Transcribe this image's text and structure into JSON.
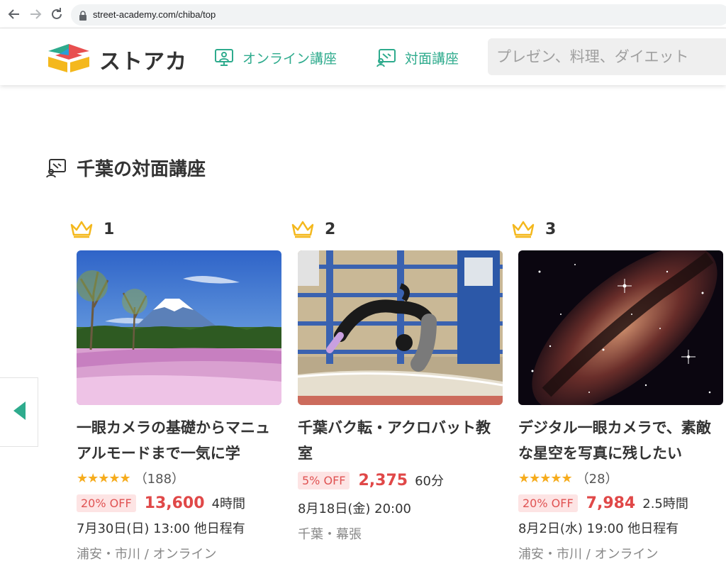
{
  "browser": {
    "url": "street-academy.com/chiba/top"
  },
  "header": {
    "logo_text": "ストアカ",
    "nav": [
      {
        "label": "オンライン講座",
        "icon": "online-class-icon"
      },
      {
        "label": "対面講座",
        "icon": "in-person-class-icon"
      }
    ],
    "search_placeholder": "プレゼン、料理、ダイエット"
  },
  "section": {
    "title": "千葉の対面講座",
    "icon": "in-person-class-icon"
  },
  "colors": {
    "accent": "#2eab8d",
    "price": "#e04848",
    "star": "#f6ac1d",
    "discount_bg": "#fde4e4"
  },
  "courses": [
    {
      "rank": "1",
      "title": "一眼カメラの基礎からマニュアルモードまで一気に学",
      "stars": "★★★★★",
      "rating_count": "（188）",
      "discount": "20% OFF",
      "price": "13,600",
      "duration": "4時間",
      "schedule": "7月30日(日) 13:00 他日程有",
      "location": "浦安・市川 / オンライン"
    },
    {
      "rank": "2",
      "title": "千葉バク転・アクロバット教室",
      "discount": "5% OFF",
      "price": "2,375",
      "duration": "60分",
      "schedule": "8月18日(金) 20:00",
      "location": "千葉・幕張"
    },
    {
      "rank": "3",
      "title": "デジタル一眼カメラで、素敵な星空を写真に残したい",
      "stars": "★★★★★",
      "rating_count": "（28）",
      "discount": "20% OFF",
      "price": "7,984",
      "duration": "2.5時間",
      "schedule": "8月2日(水) 19:00 他日程有",
      "location": "浦安・市川 / オンライン"
    }
  ]
}
